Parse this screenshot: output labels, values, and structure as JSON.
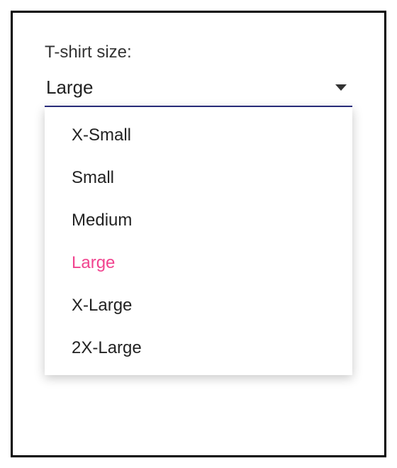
{
  "field": {
    "label": "T-shirt size:",
    "selected_value": "Large",
    "selected_index": 3,
    "options": [
      "X-Small",
      "Small",
      "Medium",
      "Large",
      "X-Large",
      "2X-Large"
    ]
  },
  "colors": {
    "underline": "#2a2e7f",
    "selected_option": "#f1448f"
  }
}
